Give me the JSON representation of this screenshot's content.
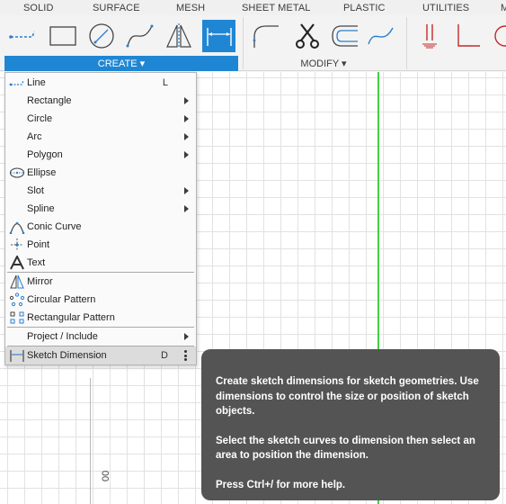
{
  "tabs": [
    "SOLID",
    "SURFACE",
    "MESH",
    "SHEET METAL",
    "PLASTIC",
    "UTILITIES",
    "M"
  ],
  "ribbon": {
    "create_label": "CREATE ▾",
    "modify_label": "MODIFY ▾",
    "accent": "#1f86d4"
  },
  "menu": {
    "items": [
      {
        "label": "Line",
        "shortcut": "L",
        "icon": "line-icon"
      },
      {
        "label": "Rectangle",
        "icon": ""
      },
      {
        "label": "Circle",
        "icon": ""
      },
      {
        "label": "Arc",
        "icon": ""
      },
      {
        "label": "Polygon",
        "icon": ""
      },
      {
        "label": "Ellipse",
        "icon": "ellipse-icon"
      },
      {
        "label": "Slot",
        "icon": ""
      },
      {
        "label": "Spline",
        "icon": ""
      },
      {
        "label": "Conic Curve",
        "icon": "conic-curve-icon"
      },
      {
        "label": "Point",
        "icon": "point-icon"
      },
      {
        "label": "Text",
        "icon": "text-icon"
      },
      {
        "label": "Mirror",
        "icon": "mirror-icon"
      },
      {
        "label": "Circular Pattern",
        "icon": "circular-pattern-icon"
      },
      {
        "label": "Rectangular Pattern",
        "icon": "rectangular-pattern-icon"
      },
      {
        "label": "Project / Include",
        "icon": ""
      },
      {
        "label": "Sketch Dimension",
        "shortcut": "D",
        "icon": "sketch-dimension-icon"
      }
    ]
  },
  "canvas": {
    "rotated_text": "00"
  },
  "tooltip": {
    "p1": "Create sketch dimensions for sketch geometries. Use dimensions to control the size or position of sketch objects.",
    "p2": "Select the sketch curves to dimension then select an area to position the dimension.",
    "p3": "Press Ctrl+/ for more help."
  }
}
